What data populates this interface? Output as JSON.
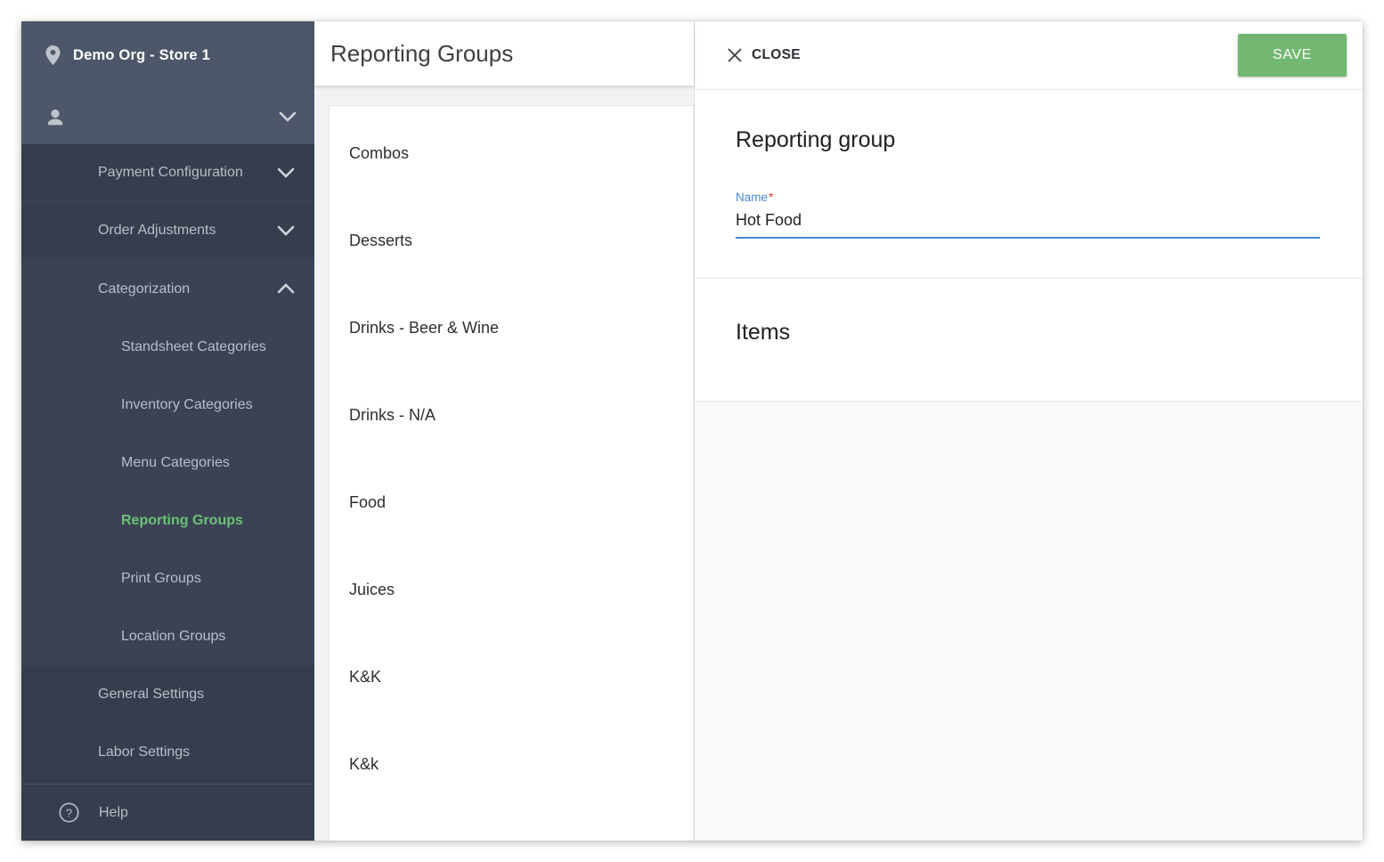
{
  "colors": {
    "sidebar_bg": "#363d4d",
    "sidebar_top_bg": "#4e5769",
    "sidebar_expanded_bg": "#3b4254",
    "accent_green": "#6cc177",
    "save_green": "#72b872",
    "focus_blue": "#4a86d8",
    "required_red": "#d23f2e",
    "panel_grey": "#f1f3f4"
  },
  "sidebar": {
    "org_label": "Demo Org - Store 1",
    "org_icon": "location-pin-icon",
    "user_name": "",
    "user_icon": "person-icon",
    "user_chevron": "chevron-down-icon",
    "sections": [
      {
        "label": "Payment Configuration",
        "chevron": "chevron-down-icon",
        "expanded": false
      },
      {
        "label": "Order Adjustments",
        "chevron": "chevron-down-icon",
        "expanded": false
      },
      {
        "label": "Categorization",
        "chevron": "chevron-up-icon",
        "expanded": true
      }
    ],
    "categorization_items": [
      {
        "label": "Standsheet Categories",
        "active": false
      },
      {
        "label": "Inventory Categories",
        "active": false
      },
      {
        "label": "Menu Categories",
        "active": false
      },
      {
        "label": "Reporting Groups",
        "active": true
      },
      {
        "label": "Print Groups",
        "active": false
      },
      {
        "label": "Location Groups",
        "active": false
      }
    ],
    "plain_items": [
      {
        "label": "General Settings"
      },
      {
        "label": "Labor Settings"
      }
    ],
    "help": {
      "label": "Help",
      "icon": "question-circle-icon"
    }
  },
  "list_panel": {
    "title": "Reporting Groups",
    "rows": [
      {
        "label": "Combos"
      },
      {
        "label": "Desserts"
      },
      {
        "label": "Drinks - Beer & Wine"
      },
      {
        "label": "Drinks - N/A"
      },
      {
        "label": "Food"
      },
      {
        "label": "Juices"
      },
      {
        "label": "K&K"
      },
      {
        "label": "K&k"
      }
    ]
  },
  "detail_panel": {
    "close_label": "CLOSE",
    "close_icon": "close-x-icon",
    "save_label": "SAVE",
    "form_title": "Reporting group",
    "name_field": {
      "label": "Name",
      "required_marker": "*",
      "value": "Hot Food",
      "placeholder": ""
    },
    "items_title": "Items"
  }
}
